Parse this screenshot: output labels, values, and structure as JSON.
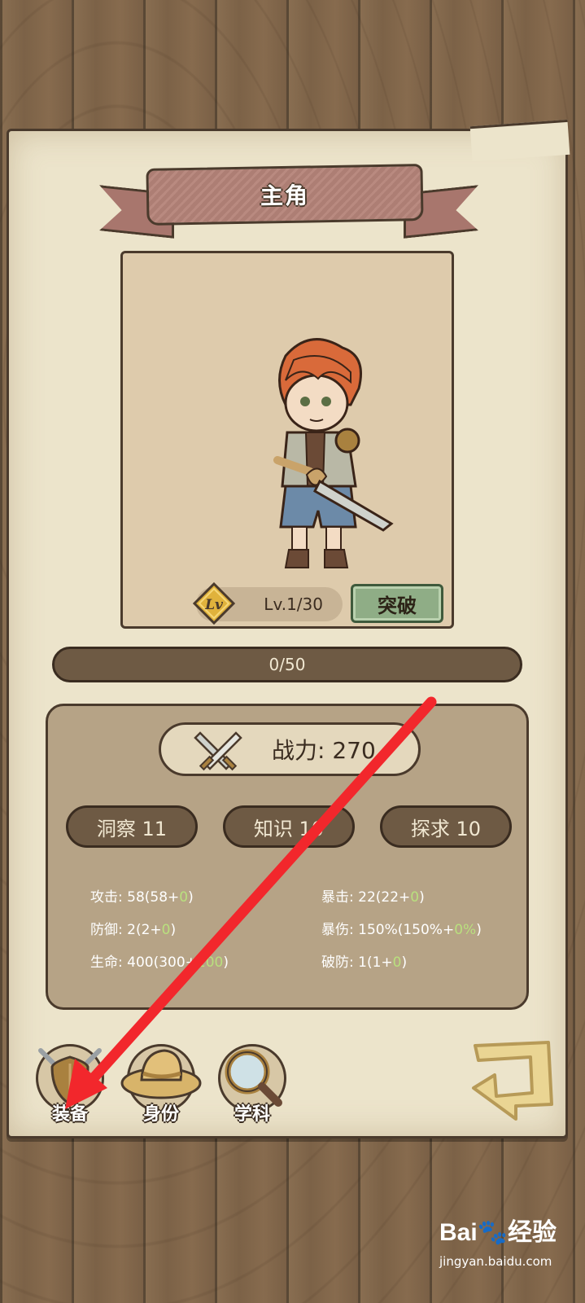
{
  "title": "主角",
  "level": {
    "badge": "Lv",
    "text": "Lv.1/30"
  },
  "breakthrough_label": "突破",
  "exp": {
    "text": "0/50",
    "current": 0,
    "max": 50
  },
  "power": {
    "label": "战力: 270"
  },
  "attributes": [
    {
      "label": "洞察 11"
    },
    {
      "label": "知识 10"
    },
    {
      "label": "探求 10"
    }
  ],
  "stats_left": [
    {
      "pre": "攻击: 58(58+",
      "green": "0",
      "post": ")"
    },
    {
      "pre": "防御: 2(2+",
      "green": "0",
      "post": ")"
    },
    {
      "pre": "生命: 400(300+",
      "green": "100",
      "post": ")"
    }
  ],
  "stats_right": [
    {
      "pre": "暴击: 22(22+",
      "green": "0",
      "post": ")"
    },
    {
      "pre": "暴伤: 150%(150%+",
      "green": "0%",
      "post": ")"
    },
    {
      "pre": "破防: 1(1+",
      "green": "0",
      "post": ")"
    }
  ],
  "bottom_buttons": [
    {
      "label": "装备",
      "icon": "shield-swords-icon"
    },
    {
      "label": "身份",
      "icon": "straw-hat-icon"
    },
    {
      "label": "学科",
      "icon": "magnifier-icon"
    }
  ],
  "watermark": {
    "brand": "Bai",
    "brand2": "经验",
    "url": "jingyan.baidu.com"
  },
  "colors": {
    "annotation_arrow": "#f2272c",
    "accent_green": "#b9e07e",
    "ribbon": "#b98a80"
  }
}
